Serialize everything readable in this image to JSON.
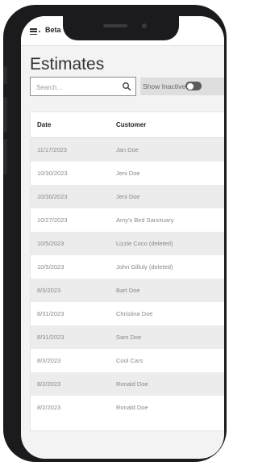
{
  "app": {
    "menu_icon": "hamburger-menu-icon",
    "beta_label": "Beta"
  },
  "page": {
    "title": "Estimates"
  },
  "search": {
    "placeholder": "Search...",
    "icon": "search-icon"
  },
  "filters": {
    "show_inactive_label": "Show Inactive",
    "show_inactive_on": false
  },
  "table": {
    "columns": [
      "Date",
      "Customer"
    ],
    "rows": [
      {
        "date": "11/17/2023",
        "customer": "Jan Doe"
      },
      {
        "date": "10/30/2023",
        "customer": "Jeni Doe"
      },
      {
        "date": "10/30/2023",
        "customer": "Jeni Doe"
      },
      {
        "date": "10/27/2023",
        "customer": "Amy's Bird Sanctuary"
      },
      {
        "date": "10/5/2023",
        "customer": "Lizzie Coco (deleted)"
      },
      {
        "date": "10/5/2023",
        "customer": "John Gilluly (deleted)"
      },
      {
        "date": "8/3/2023",
        "customer": "Bart Doe"
      },
      {
        "date": "8/31/2023",
        "customer": "Christina Doe"
      },
      {
        "date": "8/31/2023",
        "customer": "Sam Doe"
      },
      {
        "date": "8/3/2023",
        "customer": "Cool Cars"
      },
      {
        "date": "8/2/2023",
        "customer": "Ronald Doe"
      },
      {
        "date": "8/2/2023",
        "customer": "Ronald Doe"
      }
    ]
  },
  "colors": {
    "device_frame": "#1b1b1d",
    "screen_bg": "#f3f3f3",
    "row_alt": "#ececec",
    "toggle_off": "#5b5b5b"
  }
}
